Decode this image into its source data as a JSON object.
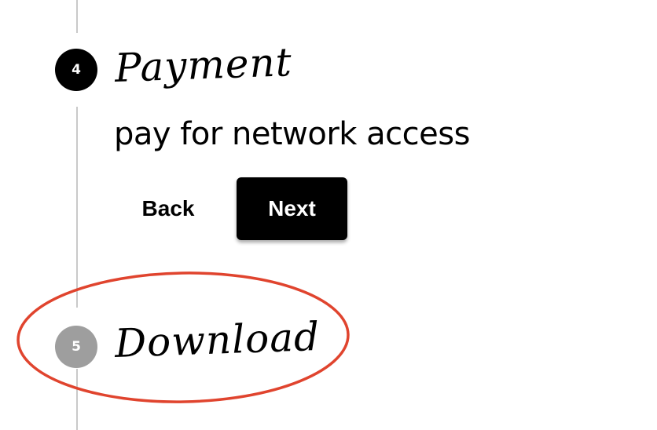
{
  "steps": [
    {
      "number": "4",
      "title": "Payment",
      "description": "pay for network access",
      "state": "active"
    },
    {
      "number": "5",
      "title": "Download",
      "state": "inactive"
    }
  ],
  "actions": {
    "back_label": "Back",
    "next_label": "Next"
  },
  "colors": {
    "active_badge": "#000000",
    "inactive_badge": "#9e9e9e",
    "rail": "#c9c9c9",
    "annotation": "#e0442e",
    "next_button": "#000000"
  },
  "annotation": {
    "shape": "oval",
    "target": "step-5-download"
  }
}
